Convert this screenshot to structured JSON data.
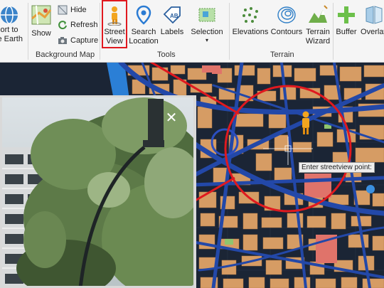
{
  "ribbon": {
    "export": {
      "label_line1": "ort to",
      "label_line2": "le Earth"
    },
    "background_map": {
      "show_label": "Show",
      "hide_label": "Hide",
      "refresh_label": "Refresh",
      "capture_label": "Capture",
      "group_label": "Background Map"
    },
    "tools": {
      "street_view_line1": "Street",
      "street_view_line2": "View",
      "search_line1": "Search",
      "search_line2": "Location",
      "labels_label": "Labels",
      "selection_label": "Selection",
      "selection_dropdown": "▾",
      "group_label": "Tools"
    },
    "terrain": {
      "elevations_label": "Elevations",
      "contours_label": "Contours",
      "terrain_wizard_line1": "Terrain",
      "terrain_wizard_line2": "Wizard",
      "group_label": "Terrain"
    },
    "buffer_label": "Buffer",
    "overlay_label": "Overlay"
  },
  "map": {
    "tooltip": "Enter streetview point:"
  },
  "street_view": {
    "close_glyph": "✕"
  }
}
